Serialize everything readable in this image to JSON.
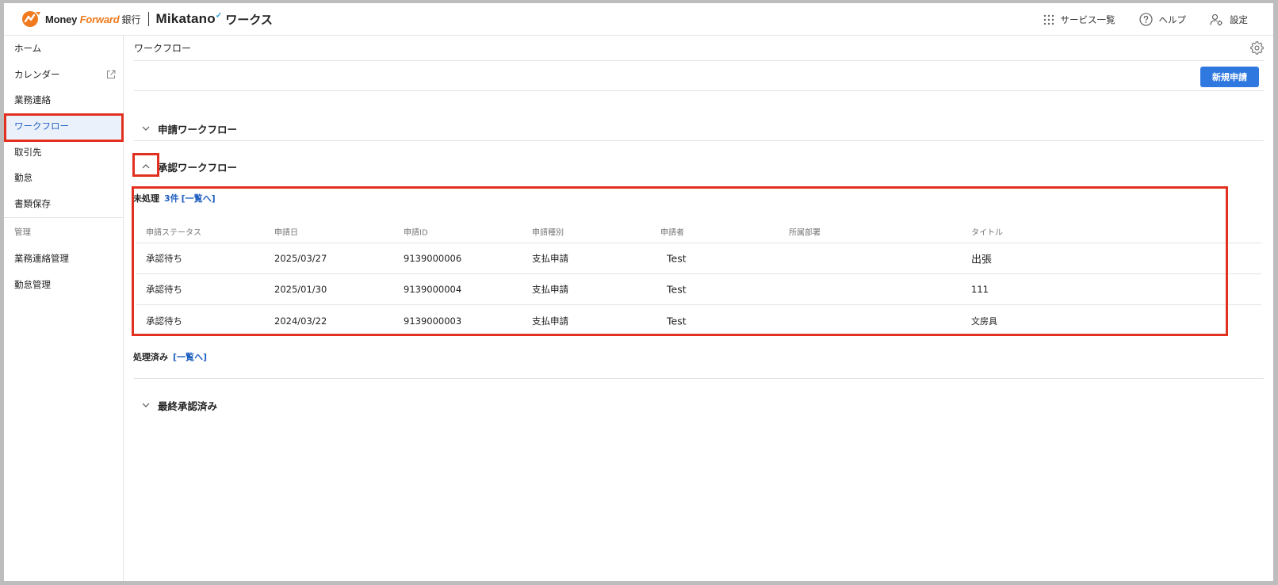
{
  "header": {
    "brand_mf_a": "Money ",
    "brand_mf_b": "Forward",
    "brand_bank": "銀行",
    "brand_product": "Mikatano",
    "brand_works": "ワークス",
    "nav": [
      {
        "label": "サービス一覧",
        "icon": "grid-icon"
      },
      {
        "label": "ヘルプ",
        "icon": "help-icon"
      },
      {
        "label": "設定",
        "icon": "user-settings-icon"
      }
    ]
  },
  "sidebar": {
    "items": [
      {
        "label": "ホーム"
      },
      {
        "label": "カレンダー",
        "icon": "external-link-icon"
      },
      {
        "label": "業務連絡"
      },
      {
        "label": "ワークフロー",
        "active": true
      },
      {
        "label": "取引先"
      },
      {
        "label": "勤怠"
      },
      {
        "label": "書類保存"
      }
    ],
    "section_label": "管理",
    "admin_items": [
      {
        "label": "業務連絡管理"
      },
      {
        "label": "勤怠管理"
      }
    ]
  },
  "main": {
    "title": "ワークフロー",
    "new_button": "新規申請",
    "sections": {
      "applied": "申請ワークフロー",
      "approval": "承認ワークフロー",
      "final": "最終承認済み"
    },
    "pending": {
      "label": "未処理",
      "count": "3件",
      "link": "[一覧へ]"
    },
    "done": {
      "label": "処理済み",
      "link": "[一覧へ]"
    },
    "table": {
      "columns": [
        "申請ステータス",
        "申請日",
        "申請ID",
        "申請種別",
        "申請者",
        "所属部署",
        "タイトル"
      ],
      "rows": [
        [
          "承認待ち",
          "2025/03/27",
          "9139000006",
          "支払申請",
          "Test",
          "",
          "出張"
        ],
        [
          "承認待ち",
          "2025/01/30",
          "9139000004",
          "支払申請",
          "Test",
          "",
          "111"
        ],
        [
          "承認待ち",
          "2024/03/22",
          "9139000003",
          "支払申請",
          "Test",
          "",
          "文房具"
        ]
      ]
    }
  },
  "colors": {
    "accent": "#2f78e0",
    "link": "#1f5fbf",
    "highlight": "#e1301f",
    "brand_orange": "#f07a1d"
  }
}
